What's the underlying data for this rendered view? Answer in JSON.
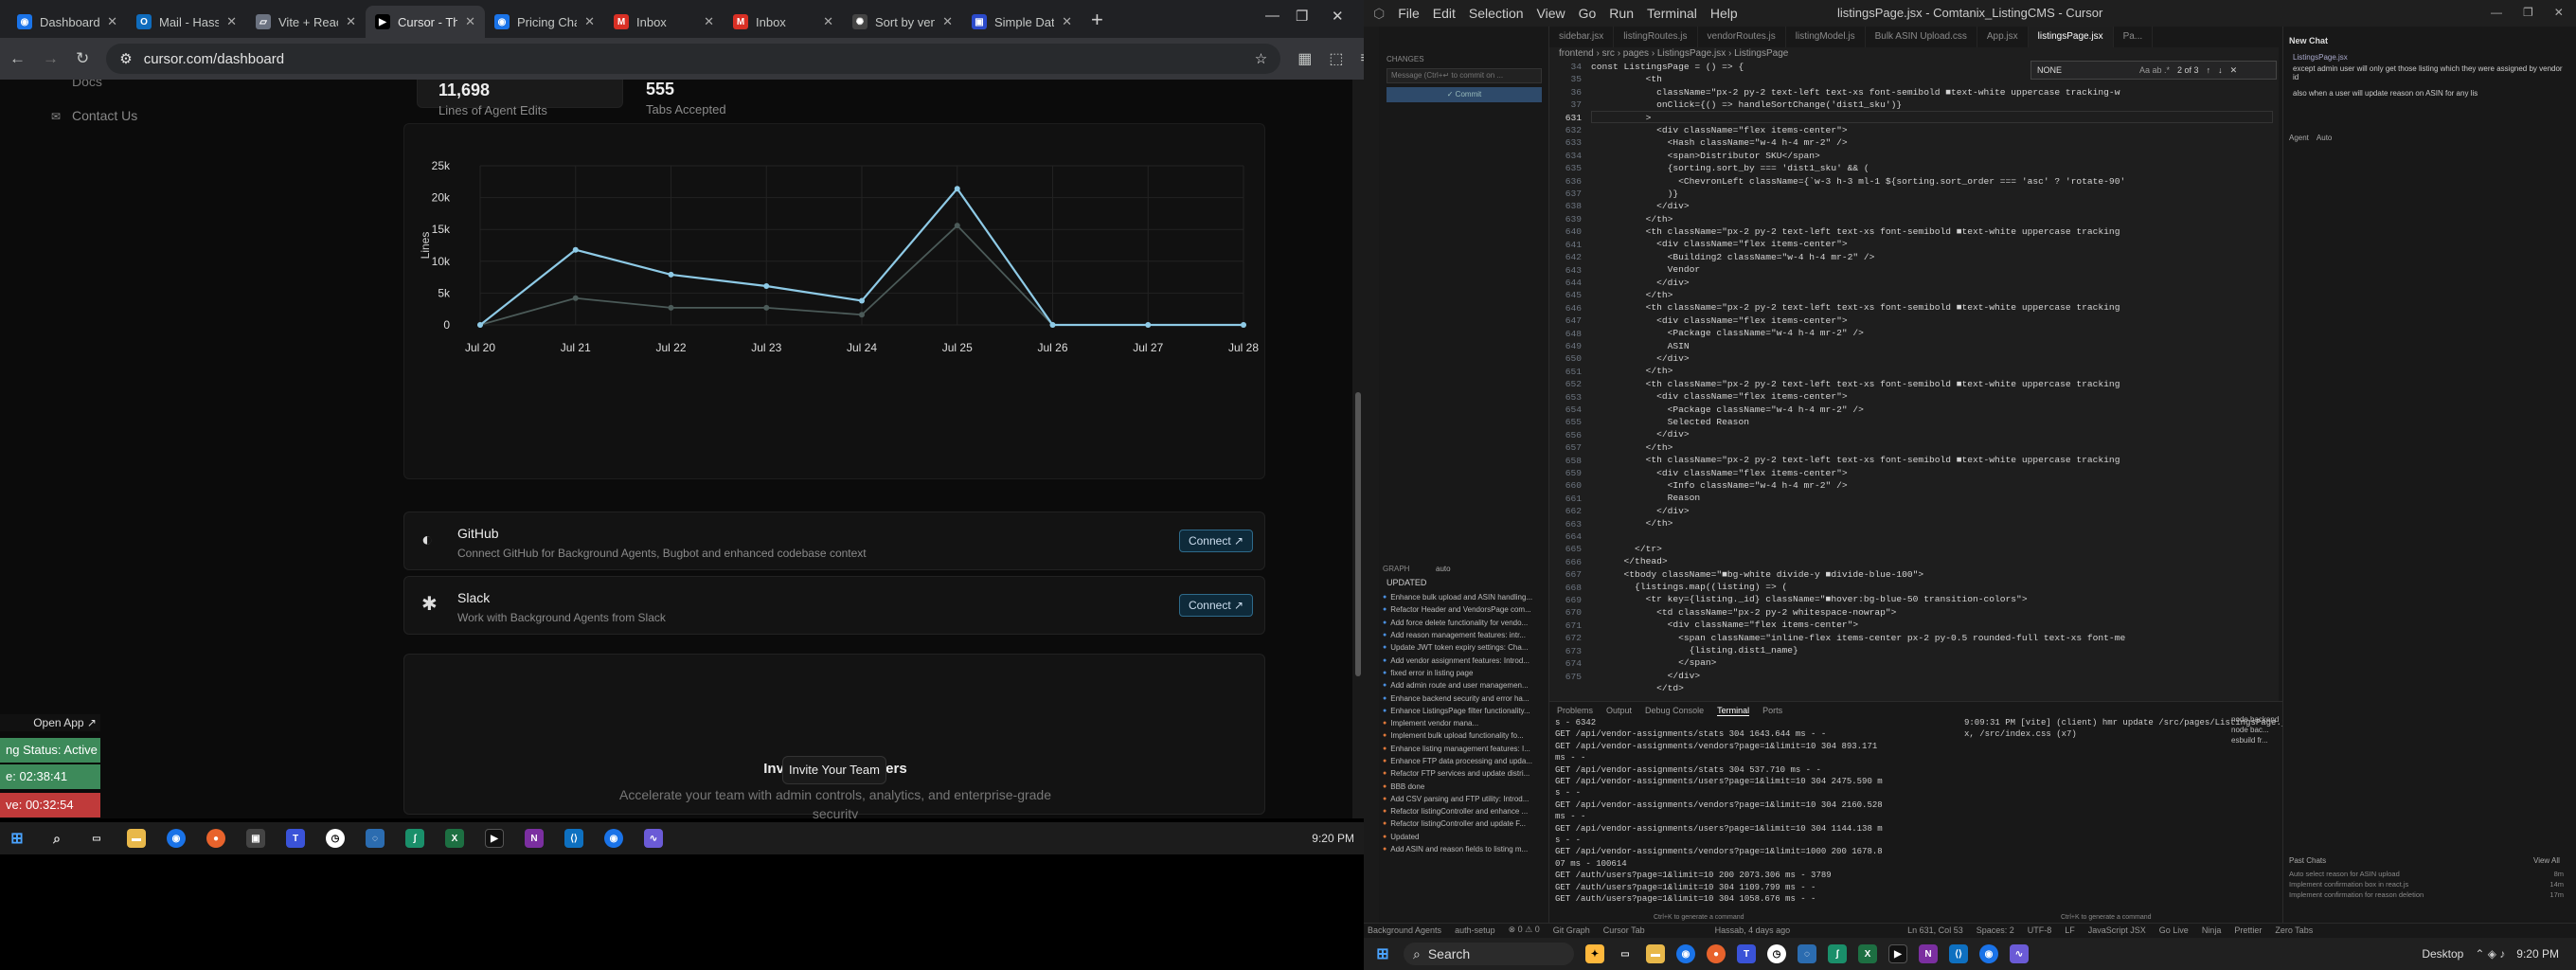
{
  "browser": {
    "tabs": [
      {
        "title": "Dashboard",
        "icon": "globe-icon",
        "color": "#1a73e8",
        "glyph": "◉"
      },
      {
        "title": "Mail - Hassa",
        "icon": "outlook-icon",
        "color": "#0f6cbd",
        "glyph": "O"
      },
      {
        "title": "Vite + React",
        "icon": "vite-icon",
        "color": "#6b7280",
        "glyph": "▱"
      },
      {
        "title": "Cursor - Th",
        "icon": "cursor-icon",
        "color": "#000000",
        "glyph": "▶"
      },
      {
        "title": "Pricing Cha",
        "icon": "globe-icon",
        "color": "#1a73e8",
        "glyph": "◉"
      },
      {
        "title": "Inbox",
        "icon": "gmail-icon",
        "color": "#d93025",
        "glyph": "M"
      },
      {
        "title": "Inbox",
        "icon": "gmail-icon",
        "color": "#d93025",
        "glyph": "M"
      },
      {
        "title": "Sort by ven",
        "icon": "chatgpt-icon",
        "color": "#444444",
        "glyph": "✺"
      },
      {
        "title": "Simple Dat",
        "icon": "notebook-icon",
        "color": "#2b4acb",
        "glyph": "▣"
      }
    ],
    "active_tab_index": 3,
    "url": "cursor.com/dashboard"
  },
  "dashboard": {
    "nav_docs": "Docs",
    "nav_contact": "Contact Us",
    "stat1_value": "11,698",
    "stat1_label": "Lines of Agent Edits",
    "stat2_value": "555",
    "stat2_label": "Tabs Accepted",
    "github": {
      "title": "GitHub",
      "desc": "Connect GitHub for Background Agents, Bugbot and enhanced codebase context",
      "button": "Connect ↗"
    },
    "slack": {
      "title": "Slack",
      "desc": "Work with Background Agents from Slack",
      "button": "Connect ↗"
    },
    "invite": {
      "title": "Invite Team Members",
      "desc": "Accelerate your team with admin controls, analytics, and enterprise-grade security",
      "button": "Invite Your Team"
    }
  },
  "chart_data": {
    "type": "line",
    "categories": [
      "Jul 20",
      "Jul 21",
      "Jul 22",
      "Jul 23",
      "Jul 24",
      "Jul 25",
      "Jul 26",
      "Jul 27",
      "Jul 28"
    ],
    "series": [
      {
        "values": [
          0,
          11800,
          7900,
          6100,
          3800,
          21400,
          0,
          0,
          0
        ],
        "color": "#8ecae6"
      },
      {
        "values": [
          0,
          4200,
          2700,
          2700,
          1600,
          15600,
          0,
          0,
          0
        ],
        "color": "#4b5a58"
      }
    ],
    "yticks": [
      "0",
      "5k",
      "10k",
      "15k",
      "20k",
      "25k"
    ],
    "ylim": [
      0,
      25000
    ],
    "ylabel": "Lines",
    "grid": true
  },
  "overlay": {
    "open_app": "Open App ↗",
    "status1": "ng Status: Active",
    "status2": "e: 02:38:41",
    "status3": "ve: 00:32:54"
  },
  "taskbar_left": {
    "time": "9:20 PM"
  },
  "ide": {
    "menu": [
      "File",
      "Edit",
      "Selection",
      "View",
      "Go",
      "Run",
      "Terminal",
      "Help"
    ],
    "window_title": "listingsPage.jsx - Comtanix_ListingCMS - Cursor",
    "tabs": [
      "sidebar.jsx",
      "listingRoutes.js",
      "vendorRoutes.js",
      "listingModel.js",
      "Bulk ASIN Upload.css",
      "App.jsx",
      "listingsPage.jsx",
      "Pa..."
    ],
    "breadcrumbs": "frontend › src › pages › ListingsPage.jsx › ListingsPage",
    "search_query": "NONE",
    "search_count": "2 of 3",
    "commit_placeholder": "Message (Ctrl+↵ to commit on ...",
    "commit_button": "✓ Commit",
    "graph_label": "GRAPH",
    "graph_filter": "auto",
    "graph_updated": "UPDATED",
    "commits": [
      "Enhance bulk upload and ASIN handling...",
      "Refactor Header and VendorsPage com...",
      "Add force delete functionality for vendo...",
      "Add reason management features: intr...",
      "Update JWT token expiry settings: Cha...",
      "Add vendor assignment features: Introd...",
      "fixed error in listing page",
      "Add admin route and user managemen...",
      "Enhance backend security and error ha...",
      "Enhance ListingsPage filter functionality...",
      "Implement vendor mana...",
      "Implement bulk upload functionality fo...",
      "Enhance listing management features: I...",
      "Enhance FTP data processing and upda...",
      "Refactor FTP services and update distri...",
      "BBB done",
      "Add CSV parsing and FTP utility: Introd...",
      "Refactor listingController and enhance ...",
      "Refactor listingController and update F...",
      "Updated",
      "Add ASIN and reason fields to listing m..."
    ],
    "line_numbers": [
      "34",
      "35",
      "36",
      "37",
      "631",
      "632",
      "633",
      "634",
      "635",
      "636",
      "637",
      "638",
      "639",
      "640",
      "641",
      "642",
      "643",
      "644",
      "645",
      "646",
      "647",
      "648",
      "649",
      "650",
      "651",
      "652",
      "653",
      "654",
      "655",
      "656",
      "657",
      "658",
      "659",
      "660",
      "661",
      "662",
      "663",
      "664",
      "665",
      "666",
      "667",
      "668",
      "669",
      "670",
      "671",
      "672",
      "673",
      "674",
      "675"
    ],
    "code_lines": [
      "const ListingsPage = () => {",
      "          <th",
      "            className=\"px-2 py-2 text-left text-xs font-semibold ■text-white uppercase tracking-w",
      "            onClick={() => handleSortChange('dist1_sku')}",
      "          >",
      "            <div className=\"flex items-center\">",
      "              <Hash className=\"w-4 h-4 mr-2\" />",
      "              <span>Distributor SKU</span>",
      "              {sorting.sort_by === 'dist1_sku' && (",
      "                <ChevronLeft className={`w-3 h-3 ml-1 ${sorting.sort_order === 'asc' ? 'rotate-90'",
      "              )}",
      "            </div>",
      "          </th>",
      "          <th className=\"px-2 py-2 text-left text-xs font-semibold ■text-white uppercase tracking",
      "            <div className=\"flex items-center\">",
      "              <Building2 className=\"w-4 h-4 mr-2\" />",
      "              Vendor",
      "            </div>",
      "          </th>",
      "          <th className=\"px-2 py-2 text-left text-xs font-semibold ■text-white uppercase tracking",
      "            <div className=\"flex items-center\">",
      "              <Package className=\"w-4 h-4 mr-2\" />",
      "              ASIN",
      "            </div>",
      "          </th>",
      "          <th className=\"px-2 py-2 text-left text-xs font-semibold ■text-white uppercase tracking",
      "            <div className=\"flex items-center\">",
      "              <Package className=\"w-4 h-4 mr-2\" />",
      "              Selected Reason",
      "            </div>",
      "          </th>",
      "          <th className=\"px-2 py-2 text-left text-xs font-semibold ■text-white uppercase tracking",
      "            <div className=\"flex items-center\">",
      "              <Info className=\"w-4 h-4 mr-2\" />",
      "              Reason",
      "            </div>",
      "          </th>",
      "",
      "        </tr>",
      "      </thead>",
      "      <tbody className=\"■bg-white divide-y ■divide-blue-100\">",
      "        {listings.map((listing) => (",
      "          <tr key={listing._id} className=\"■hover:bg-blue-50 transition-colors\">",
      "            <td className=\"px-2 py-2 whitespace-nowrap\">",
      "              <div className=\"flex items-center\">",
      "                <span className=\"inline-flex items-center px-2 py-0.5 rounded-full text-xs font-me",
      "                  {listing.dist1_name}",
      "                </span>",
      "              </div>",
      "            </td>"
    ],
    "panel_tabs": [
      "Problems",
      "Output",
      "Debug Console",
      "Terminal",
      "Ports"
    ],
    "terminal_left": [
      "s - 6342",
      "GET /api/vendor-assignments/stats 304 1643.644 ms - -",
      "GET /api/vendor-assignments/vendors?page=1&limit=10 304 893.171",
      "ms - -",
      "GET /api/vendor-assignments/stats 304 537.710 ms - -",
      "GET /api/vendor-assignments/users?page=1&limit=10 304 2475.590 m",
      "s - -",
      "GET /api/vendor-assignments/vendors?page=1&limit=10 304 2160.528",
      "ms - -",
      "GET /api/vendor-assignments/users?page=1&limit=10 304 1144.138 m",
      "s - -",
      "GET /api/vendor-assignments/vendors?page=1&limit=1000 200 1678.8",
      "07 ms - 100614",
      "GET /auth/users?page=1&limit=10 200 2073.306 ms - 3789",
      "GET /auth/users?page=1&limit=10 304 1109.799 ms - -",
      "GET /auth/users?page=1&limit=10 304 1058.676 ms - -"
    ],
    "terminal_right": [
      "9:09:31 PM [vite] (client) hmr update /src/pages/ListingsPage.js",
      "x, /src/index.css (x7)"
    ],
    "terminal_sessions": [
      "node  backend",
      "node  bac...",
      "esbuild  fr..."
    ],
    "terminal_hint": "Ctrl+K to generate a command",
    "chat": {
      "title": "New Chat",
      "file_chip": "ListingsPage.jsx",
      "msg1": "except admin user will only get those listing which they were assigned by vendor id",
      "msg2": "also when a user will update reason on ASIN for any lis",
      "mode": "Agent",
      "model": "Auto",
      "past_title": "Past Chats",
      "view_all": "View All",
      "past": [
        {
          "t": "Auto select reason for ASIN upload",
          "age": "8m"
        },
        {
          "t": "Implement confirmation box in react.js",
          "age": "14m"
        },
        {
          "t": "Implement confirmation for reason deletion",
          "age": "17m"
        }
      ]
    },
    "status_items": [
      "Background Agents",
      "auth-setup",
      "⊗ 0 ⚠ 0",
      "Git Graph",
      "Cursor Tab",
      "Hassab, 4 days ago",
      "Ln 631, Col 53",
      "Spaces: 2",
      "UTF-8",
      "LF",
      "JavaScript JSX",
      "Go Live",
      "Ninja",
      "Prettier",
      "Zero Tabs"
    ]
  },
  "taskbar_right": {
    "search": "Search",
    "time": "9:20 PM",
    "desktop": "Desktop"
  }
}
